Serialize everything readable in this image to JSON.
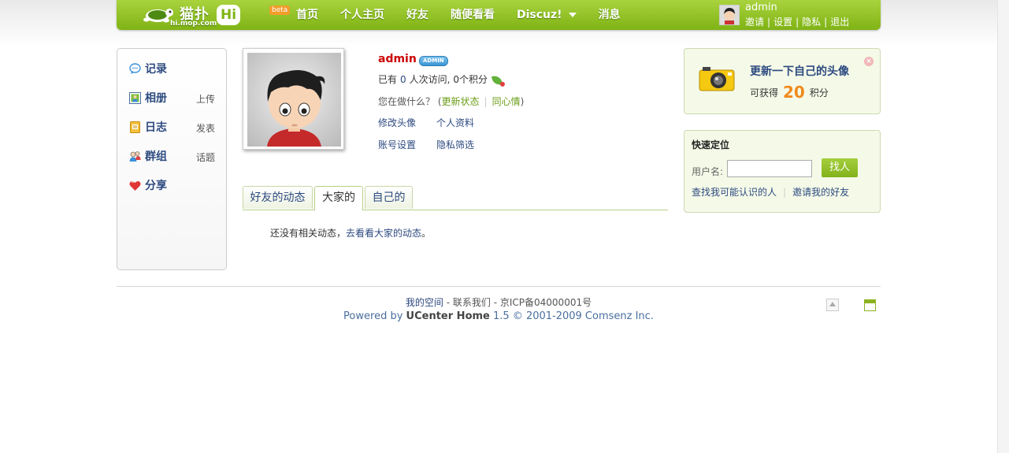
{
  "header": {
    "logo_name": "猫扑",
    "logo_domain": "hi.mop.com",
    "logo_hi": "Hi",
    "logo_beta": "beta",
    "nav": [
      "首页",
      "个人主页",
      "好友",
      "随便看看",
      "Discuz!",
      "消息"
    ],
    "user": {
      "name": "admin",
      "links": [
        "邀请",
        "设置",
        "隐私",
        "退出"
      ]
    }
  },
  "sidebar": {
    "items": [
      {
        "label": "记录",
        "extra": "",
        "icon": "speech-bubble-icon"
      },
      {
        "label": "相册",
        "extra": "上传",
        "icon": "photo-icon"
      },
      {
        "label": "日志",
        "extra": "发表",
        "icon": "journal-icon"
      },
      {
        "label": "群组",
        "extra": "话题",
        "icon": "group-icon"
      },
      {
        "label": "分享",
        "extra": "",
        "icon": "heart-icon"
      }
    ]
  },
  "profile": {
    "name": "admin",
    "badge": "ADMIN",
    "visits_prefix": "已有",
    "visits_count": "0",
    "visits_middle": "人次访问,",
    "points_count": "0",
    "points_suffix": "个积分",
    "doing_prompt": "您在做什么？",
    "doing_open": "(",
    "update_status": "更新状态",
    "empathy": "同心情",
    "doing_close": ")",
    "links": [
      "修改头像",
      "个人资料",
      "账号设置",
      "隐私筛选"
    ]
  },
  "tabs": [
    {
      "label": "好友的动态",
      "active": false
    },
    {
      "label": "大家的",
      "active": true
    },
    {
      "label": "自己的",
      "active": false
    }
  ],
  "feed": {
    "empty_text": "还没有相关动态，",
    "empty_link": "去看看大家的动态",
    "empty_end": "。"
  },
  "promo": {
    "title": "更新一下自己的头像",
    "sub_prefix": "可获得",
    "points": "20",
    "sub_suffix": "积分",
    "close": "×"
  },
  "locate": {
    "title": "快速定位",
    "label": "用户名:",
    "input_value": "",
    "button": "找人",
    "link1": "查找我可能认识的人",
    "link2": "邀请我的好友"
  },
  "footer": {
    "my_space": "我的空间",
    "contact": "- 联系我们",
    "icp": "- 京ICP备04000001号",
    "powered_prefix": "Powered by",
    "product": "UCenter Home",
    "version_copy": "1.5 © 2001-2009 Comsenz Inc."
  },
  "colors": {
    "header_green": "#8ec02a",
    "link_blue": "#2d4a80",
    "name_red": "#cc0000",
    "points_orange": "#f08a1c"
  }
}
